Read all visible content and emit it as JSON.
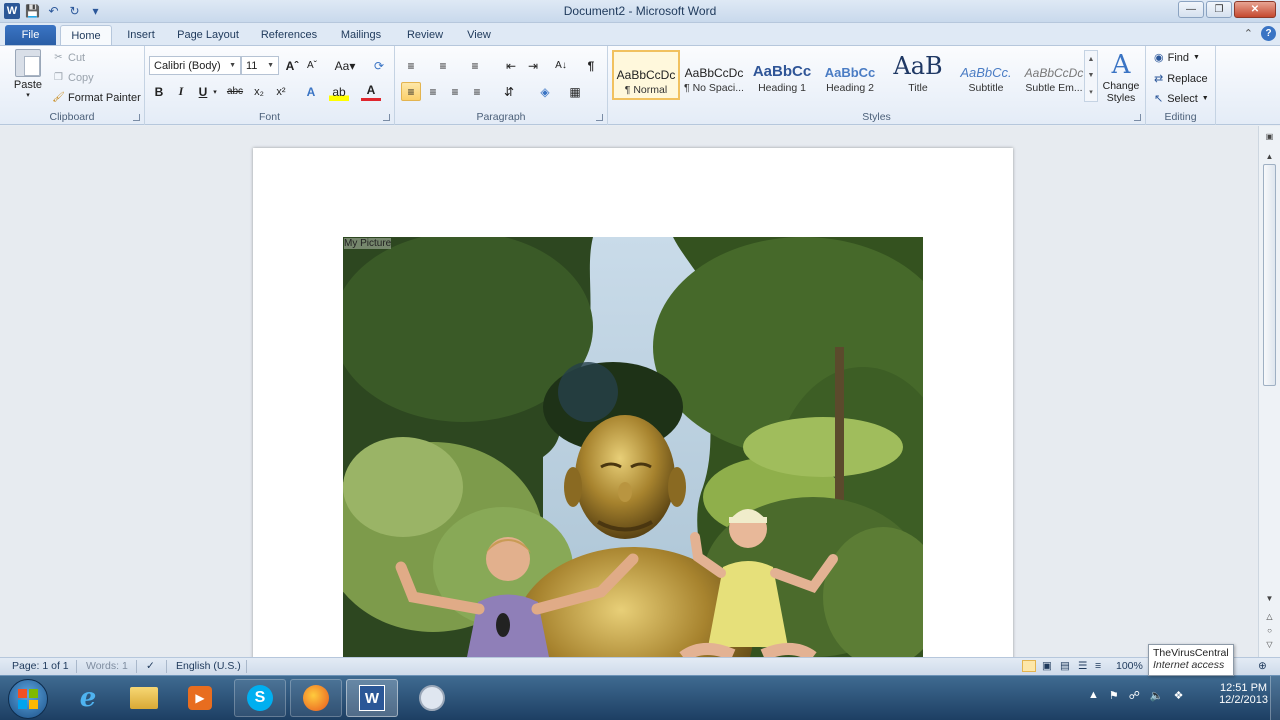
{
  "window": {
    "title": "Document2 - Microsoft Word"
  },
  "tabs": [
    "File",
    "Home",
    "Insert",
    "Page Layout",
    "References",
    "Mailings",
    "Review",
    "View"
  ],
  "clipboard": {
    "paste": "Paste",
    "cut": "Cut",
    "copy": "Copy",
    "format_painter": "Format Painter",
    "label": "Clipboard"
  },
  "font": {
    "name": "Calibri (Body)",
    "size": "11",
    "change_case": "Aa",
    "label": "Font"
  },
  "paragraph": {
    "label": "Paragraph"
  },
  "styles": {
    "label": "Styles",
    "items": [
      {
        "sample": "AaBbCcDc",
        "name": "¶ Normal"
      },
      {
        "sample": "AaBbCcDc",
        "name": "¶ No Spaci..."
      },
      {
        "sample": "AaBbCc",
        "name": "Heading 1"
      },
      {
        "sample": "AaBbCc",
        "name": "Heading 2"
      },
      {
        "sample": "AaB",
        "name": "Title"
      },
      {
        "sample": "AaBbCc.",
        "name": "Subtitle"
      },
      {
        "sample": "AaBbCcDc",
        "name": "Subtle Em..."
      }
    ],
    "change_styles": "Change Styles"
  },
  "editing": {
    "find": "Find",
    "replace": "Replace",
    "select": "Select",
    "label": "Editing"
  },
  "document": {
    "caption": "My Picture"
  },
  "status": {
    "page": "Page: 1 of 1",
    "words": "Words: 1",
    "language": "English (U.S.)",
    "zoom": "100%"
  },
  "tooltip": {
    "line1": "TheVirusCentral",
    "line2": "Internet access"
  },
  "clock": {
    "time": "12:51 PM",
    "date": "12/2/2013"
  },
  "colors": {
    "file_tab": "#2a5ea6",
    "ribbon_bg": "#e4ecf7",
    "taskbar": "#1d3f63",
    "active_style": "#f1c15f"
  }
}
